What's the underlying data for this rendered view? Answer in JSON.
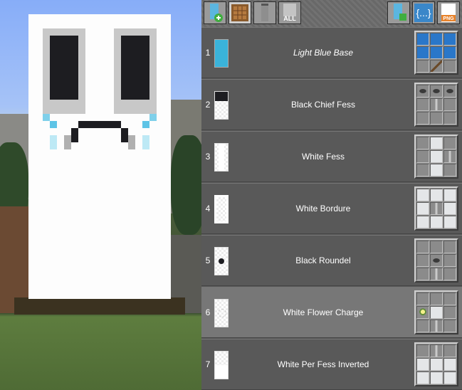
{
  "toolbar": {
    "buttons": [
      {
        "name": "new-banner-button",
        "icon": "banner-plus-icon"
      },
      {
        "name": "crafting-table-button",
        "icon": "crafting-table-icon"
      },
      {
        "name": "banner-button",
        "icon": "gray-banner-icon"
      },
      {
        "name": "all-button",
        "icon": "all-icon",
        "label": "ALL"
      },
      {
        "name": "export-button",
        "icon": "banner-export-icon"
      },
      {
        "name": "json-button",
        "icon": "braces-icon",
        "label": "{...}"
      },
      {
        "name": "png-button",
        "icon": "png-icon",
        "label": "PNG"
      }
    ]
  },
  "layers": [
    {
      "num": "1",
      "name": "Light Blue Base",
      "italic": true
    },
    {
      "num": "2",
      "name": "Black Chief Fess"
    },
    {
      "num": "3",
      "name": "White Fess"
    },
    {
      "num": "4",
      "name": "White Bordure"
    },
    {
      "num": "5",
      "name": "Black Roundel"
    },
    {
      "num": "6",
      "name": "White Flower Charge",
      "highlighted": true
    },
    {
      "num": "7",
      "name": "White Per Fess Inverted"
    }
  ],
  "colors": {
    "light_blue": "#3ab3da",
    "black": "#1d1d21",
    "white": "#f9fffe",
    "panel": "#585858"
  }
}
